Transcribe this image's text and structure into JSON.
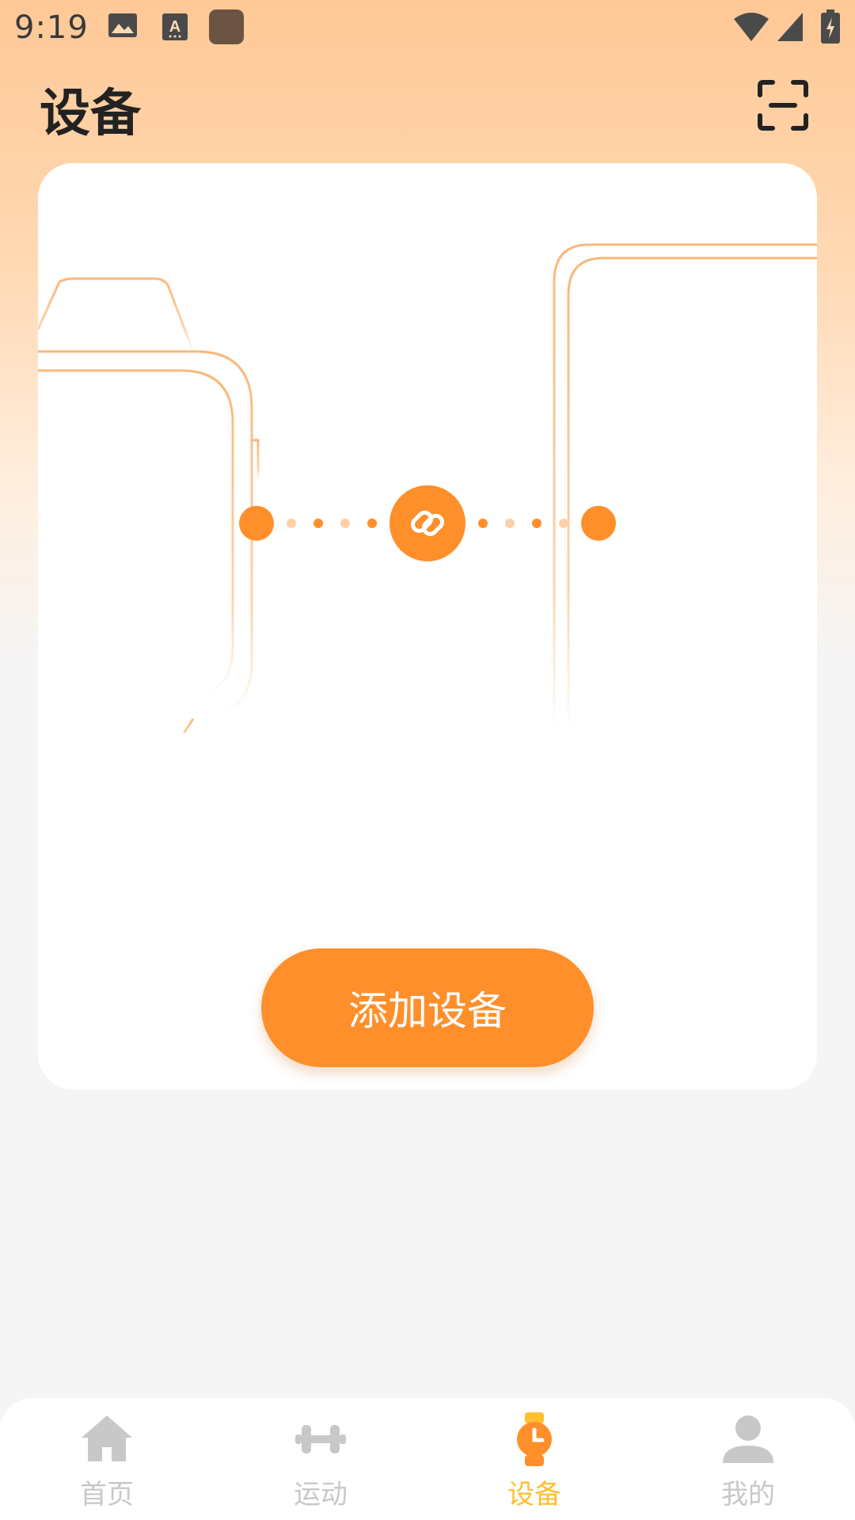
{
  "status_bar": {
    "time": "9:19",
    "icons": [
      "gallery-icon",
      "a-icon",
      "app-icon",
      "wifi-icon",
      "signal-icon",
      "battery-icon"
    ]
  },
  "header": {
    "title": "设备",
    "scan_icon": "scan-icon"
  },
  "card": {
    "illustration": {
      "left": "watch-outline",
      "center": "link-icon",
      "right": "phone-outline"
    },
    "add_button_label": "添加设备"
  },
  "bottom_nav": {
    "items": [
      {
        "label": "首页",
        "icon": "home-icon",
        "active": false
      },
      {
        "label": "运动",
        "icon": "dumbbell-icon",
        "active": false
      },
      {
        "label": "设备",
        "icon": "watch-icon",
        "active": true
      },
      {
        "label": "我的",
        "icon": "person-icon",
        "active": false
      }
    ]
  },
  "colors": {
    "accent": "#ff8f2a",
    "active_nav": "#ffbf2e",
    "inactive_nav": "#c8c8c8",
    "header_gradient_top": "#ffc896"
  }
}
